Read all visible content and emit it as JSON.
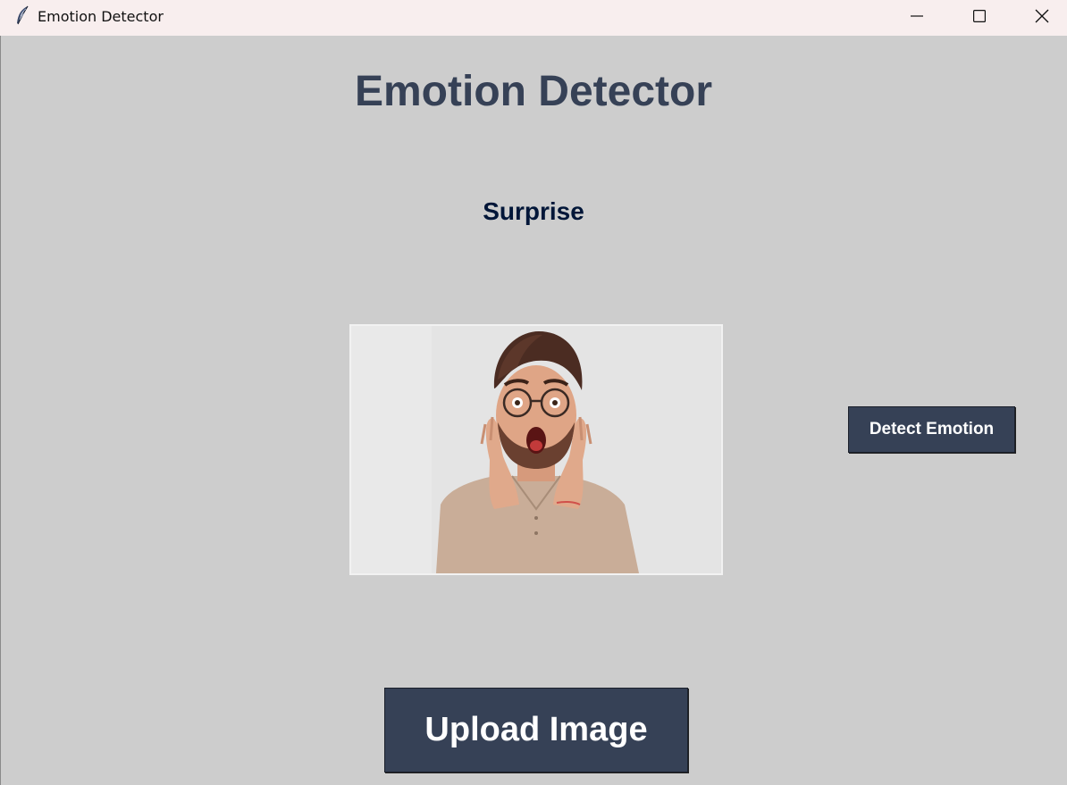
{
  "window": {
    "title": "Emotion Detector",
    "icon": "feather-icon"
  },
  "controls": {
    "minimize": "minimize-icon",
    "maximize": "maximize-icon",
    "close": "close-icon"
  },
  "main": {
    "heading": "Emotion Detector",
    "result": "Surprise",
    "detect_button": "Detect Emotion",
    "upload_button": "Upload Image"
  },
  "colors": {
    "background": "#cdcdcd",
    "titlebar": "#f8eeee",
    "heading": "#364156",
    "result": "#011638",
    "button_bg": "#364156",
    "button_text": "#ffffff"
  }
}
